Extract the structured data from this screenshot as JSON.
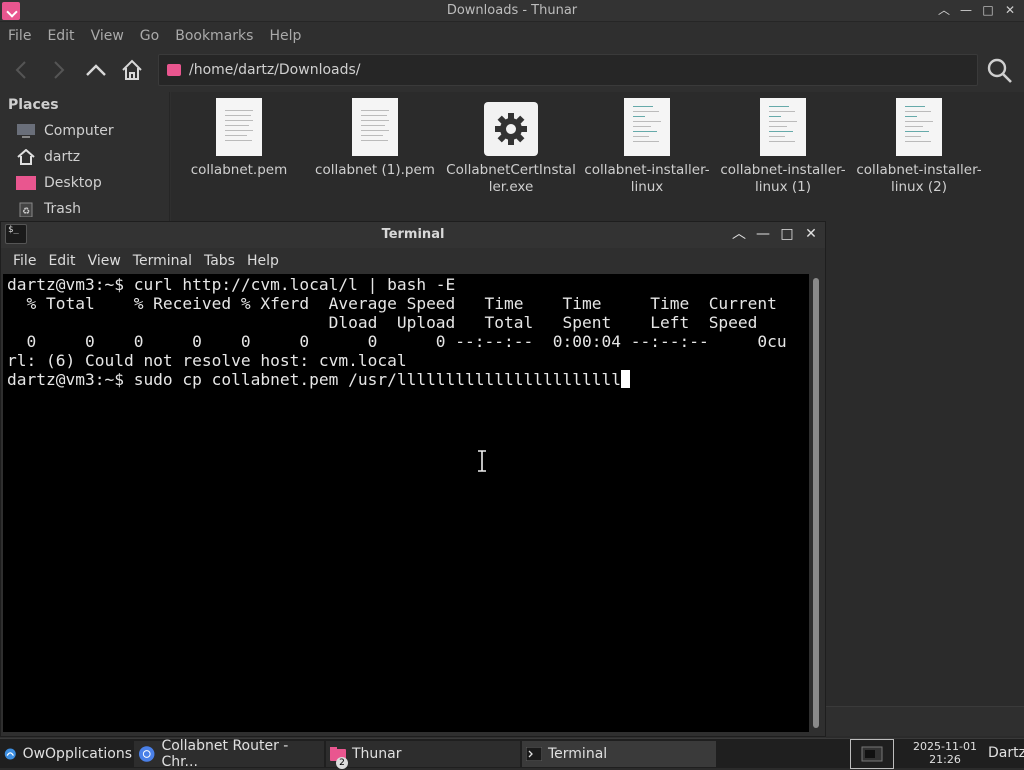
{
  "thunar": {
    "title": "Downloads - Thunar",
    "menu": [
      "File",
      "Edit",
      "View",
      "Go",
      "Bookmarks",
      "Help"
    ],
    "path": "/home/dartz/Downloads/",
    "places_header": "Places",
    "places": [
      {
        "label": "Computer",
        "icon": "computer-icon"
      },
      {
        "label": "dartz",
        "icon": "home-icon"
      },
      {
        "label": "Desktop",
        "icon": "desktop-icon"
      },
      {
        "label": "Trash",
        "icon": "trash-icon"
      }
    ],
    "files": [
      {
        "line1": "collabnet.pem",
        "line2": "",
        "icon": "text-file-icon"
      },
      {
        "line1": "collabnet (1).pem",
        "line2": "",
        "icon": "text-file-icon"
      },
      {
        "line1": "CollabnetCertInstal",
        "line2": "ler.exe",
        "icon": "gear-icon"
      },
      {
        "line1": "collabnet-installer-",
        "line2": "linux",
        "icon": "script-file-icon"
      },
      {
        "line1": "collabnet-installer-",
        "line2": "linux (1)",
        "icon": "script-file-icon"
      },
      {
        "line1": "collabnet-installer-",
        "line2": "linux (2)",
        "icon": "script-file-icon"
      }
    ]
  },
  "terminal": {
    "title": "Terminal",
    "menu": [
      "File",
      "Edit",
      "View",
      "Terminal",
      "Tabs",
      "Help"
    ],
    "lines": [
      "dartz@vm3:~$ curl http://cvm.local/l | bash -E",
      "  % Total    % Received % Xferd  Average Speed   Time    Time     Time  Current",
      "                                 Dload  Upload   Total   Spent    Left  Speed",
      "  0     0    0     0    0     0      0      0 --:--:--  0:00:04 --:--:--     0cu",
      "rl: (6) Could not resolve host: cvm.local"
    ],
    "prompt_line": "dartz@vm3:~$ sudo cp collabnet.pem /usr/lllllllllllllllllllllll"
  },
  "taskbar": {
    "apps_label": "OwOpplications",
    "tasks": [
      {
        "label": "Collabnet Router - Chr...",
        "icon": "chrome-icon"
      },
      {
        "label": "Thunar",
        "icon": "folder-icon",
        "badge": "2"
      },
      {
        "label": "Terminal",
        "icon": "terminal-icon"
      }
    ],
    "date": "2025-11-01",
    "time": "21:26",
    "user": "Dartz"
  },
  "colors": {
    "accent": "#e9568f",
    "terminal_bg": "#000000",
    "window_bg": "#2f2f2f"
  }
}
